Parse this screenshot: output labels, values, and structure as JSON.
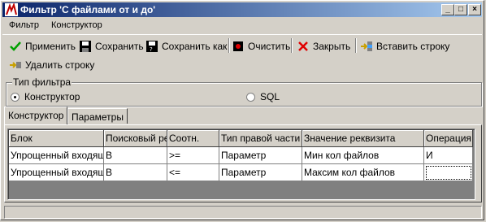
{
  "window": {
    "title": "Фильтр 'С файлами от и до'"
  },
  "menu": [
    {
      "label": "Фильтр"
    },
    {
      "label": "Конструктор"
    }
  ],
  "toolbar": {
    "apply": "Применить",
    "save": "Сохранить",
    "save_as": "Сохранить как",
    "clear": "Очистить",
    "close": "Закрыть",
    "insert_row": "Вставить строку",
    "delete_row": "Удалить строку"
  },
  "filter_type": {
    "legend": "Тип фильтра",
    "options": [
      {
        "label": "Конструктор",
        "selected": true
      },
      {
        "label": "SQL",
        "selected": false
      }
    ]
  },
  "tabs": [
    {
      "label": "Конструктор",
      "active": true
    },
    {
      "label": "Параметры",
      "active": false
    }
  ],
  "grid": {
    "columns": [
      "Блок",
      "Поисковый ре",
      "Соотн.",
      "Тип правой части",
      "Значение реквизита",
      "Операция"
    ],
    "rows": [
      [
        "Упрощенный входящи",
        "В",
        ">=",
        "Параметр",
        "Мин кол  файлов",
        "И"
      ],
      [
        "Упрощенный входящи",
        "В",
        "<=",
        "Параметр",
        "Максим  кол файлов",
        ""
      ]
    ]
  },
  "colors": {
    "titlebar_start": "#0a246a",
    "titlebar_end": "#a6caf0",
    "face": "#d4d0c8"
  }
}
